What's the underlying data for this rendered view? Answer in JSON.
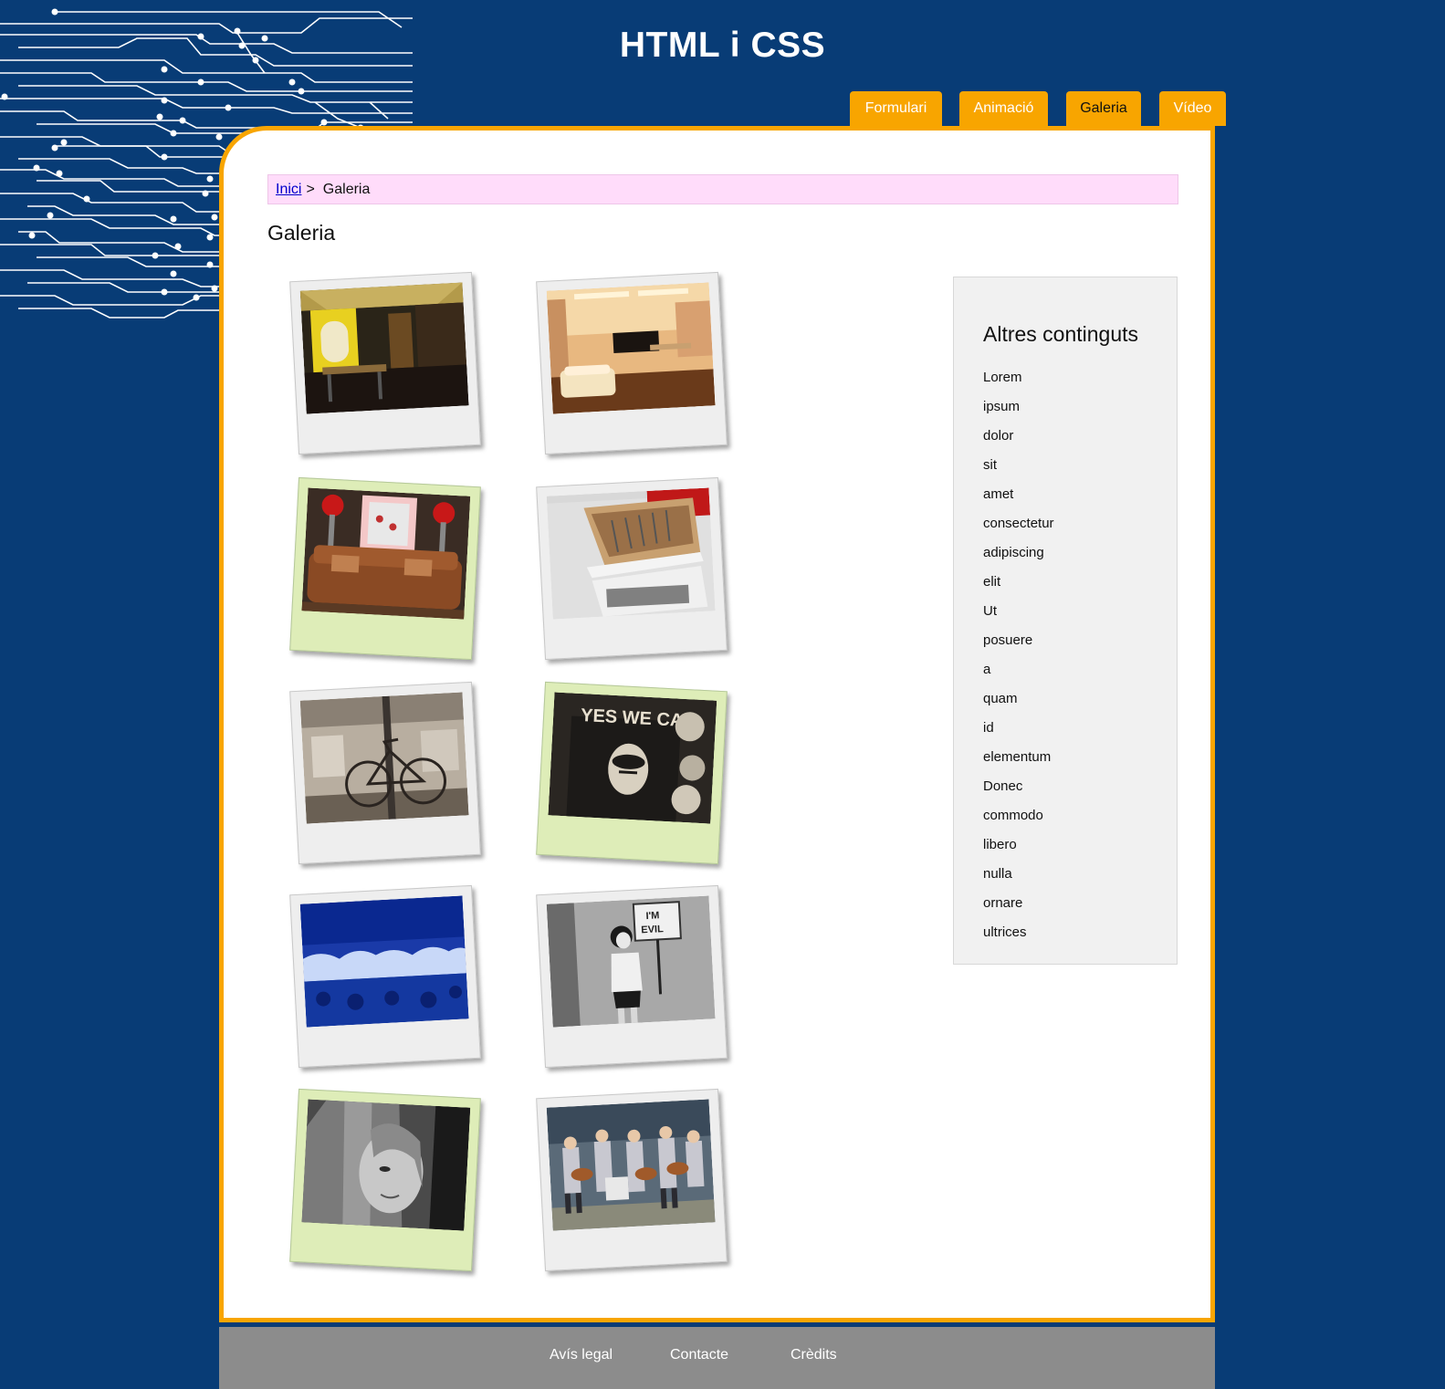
{
  "header": {
    "title": "HTML i CSS",
    "nav": [
      {
        "label": "Formulari",
        "active": false
      },
      {
        "label": "Animació",
        "active": false
      },
      {
        "label": "Galeria",
        "active": true
      },
      {
        "label": "Vídeo",
        "active": false
      }
    ]
  },
  "breadcrumb": {
    "home_label": "Inici",
    "separator": ">",
    "current": "Galeria"
  },
  "page_title": "Galeria",
  "gallery": {
    "photos": [
      {
        "subject": "restaurant-interior-photo",
        "frame": "gray"
      },
      {
        "subject": "living-room-photo",
        "frame": "gray"
      },
      {
        "subject": "sofa-flowers-photo",
        "frame": "green"
      },
      {
        "subject": "kitchen-drawer-photo",
        "frame": "gray"
      },
      {
        "subject": "bicycle-sepia-photo",
        "frame": "gray"
      },
      {
        "subject": "yes-we-can-poster-photo",
        "frame": "green"
      },
      {
        "subject": "blue-forest-photo",
        "frame": "gray"
      },
      {
        "subject": "im-evil-sign-photo",
        "frame": "gray"
      },
      {
        "subject": "woman-face-bw-photo",
        "frame": "green"
      },
      {
        "subject": "band-vintage-photo",
        "frame": "gray"
      }
    ]
  },
  "sidebar": {
    "title": "Altres continguts",
    "items": [
      "Lorem",
      "ipsum",
      "dolor",
      "sit",
      "amet",
      "consectetur",
      "adipiscing",
      "elit",
      "Ut",
      "posuere",
      "a",
      "quam",
      "id",
      "elementum",
      "Donec",
      "commodo",
      "libero",
      "nulla",
      "ornare",
      "ultrices"
    ]
  },
  "footer": {
    "links": [
      "Avís legal",
      "Contacte",
      "Crèdits"
    ]
  },
  "colors": {
    "background": "#083c76",
    "accent": "#f8a500",
    "breadcrumb_bg": "#ffdcfa",
    "sidebar_bg": "#f1f1f1",
    "footer_bg": "#8c8c8c",
    "frame_gray": "#eeeeee",
    "frame_green": "#deedb8"
  }
}
